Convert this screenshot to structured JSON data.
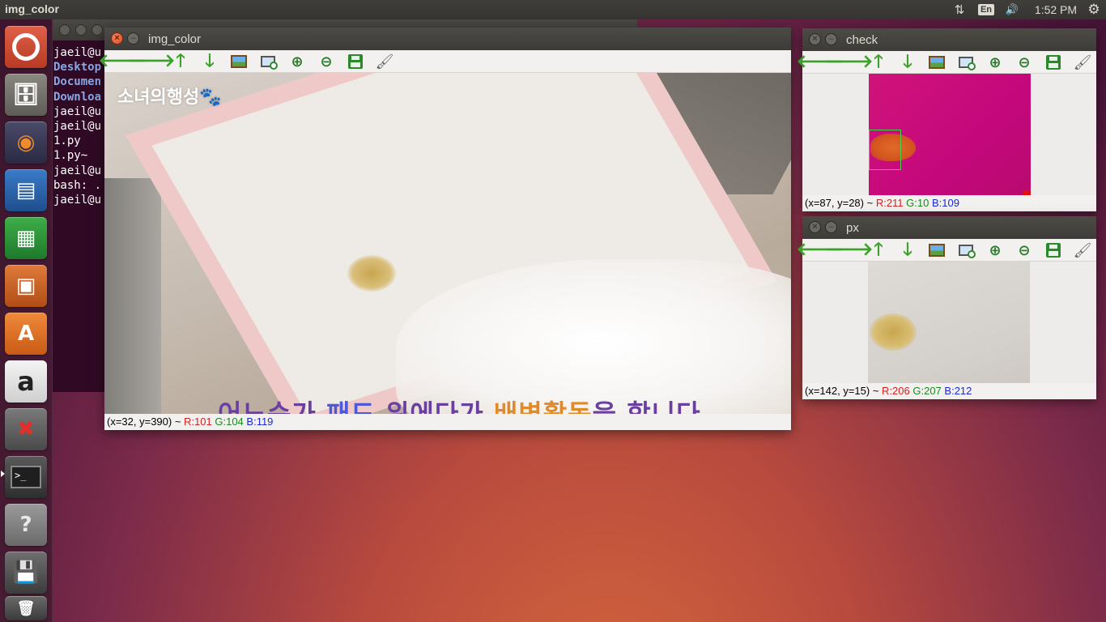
{
  "top_panel": {
    "title": "img_color",
    "keyboard_layout": "En",
    "clock": "1:52 PM",
    "network_icon": "network-updown-icon",
    "volume_icon": "volume-icon",
    "settings_icon": "gear-icon"
  },
  "launcher": {
    "items": [
      {
        "name": "ubuntu-dash",
        "icon": "ubuntu-logo-icon"
      },
      {
        "name": "files",
        "icon": "file-cabinet-icon"
      },
      {
        "name": "firefox",
        "icon": "firefox-icon"
      },
      {
        "name": "libreoffice-writer",
        "icon": "writer-icon"
      },
      {
        "name": "libreoffice-calc",
        "icon": "calc-icon"
      },
      {
        "name": "libreoffice-impress",
        "icon": "impress-icon"
      },
      {
        "name": "ubuntu-software",
        "icon": "software-bag-icon",
        "glyph": "A"
      },
      {
        "name": "amazon",
        "icon": "amazon-icon",
        "glyph": "a"
      },
      {
        "name": "system-settings",
        "icon": "settings-wrench-icon"
      },
      {
        "name": "terminal",
        "icon": "terminal-icon",
        "glyph": ">_"
      },
      {
        "name": "help",
        "icon": "help-icon",
        "glyph": "?"
      },
      {
        "name": "save-disk",
        "icon": "floppy-icon"
      },
      {
        "name": "trash",
        "icon": "trash-icon"
      }
    ]
  },
  "terminal": {
    "lines": [
      {
        "text": "jaeil@u",
        "style": "plain"
      },
      {
        "text": "Desktop",
        "style": "blue"
      },
      {
        "text": "Documen",
        "style": "blue"
      },
      {
        "text": "Downloa",
        "style": "blue"
      },
      {
        "text": "jaeil@u",
        "style": "plain"
      },
      {
        "text": "jaeil@u",
        "style": "plain"
      },
      {
        "text": "1.py",
        "style": "plain"
      },
      {
        "text": "1.py~",
        "style": "plain"
      },
      {
        "text": "jaeil@u",
        "style": "plain"
      },
      {
        "text": "bash: .",
        "style": "plain"
      },
      {
        "text": "jaeil@u",
        "style": "plain"
      }
    ]
  },
  "img_color_window": {
    "title": "img_color",
    "close_glyph": "×",
    "min_glyph": "–",
    "watermark": "소녀의행성🐾",
    "subtitle_parts": [
      "어느순가 ",
      "패드",
      " 위에다가 ",
      "배변활동",
      "을 합니다"
    ],
    "status": {
      "coords": "(x=32, y=390) ~ ",
      "r": "R:101",
      "g": "G:104",
      "b": "B:119"
    }
  },
  "check_window": {
    "title": "check",
    "close_glyph": "×",
    "min_glyph": "–",
    "status": {
      "coords": "(x=87, y=28) ~ ",
      "r": "R:211",
      "g": "G:10",
      "b": "B:109"
    }
  },
  "px_window": {
    "title": "px",
    "close_glyph": "×",
    "min_glyph": "–",
    "status": {
      "coords": "(x=142, y=15) ~ ",
      "r": "R:206",
      "g": "G:207",
      "b": "B:212"
    }
  },
  "toolbar": {
    "left_arrow": "🡐",
    "right_arrow": "🡒",
    "up_arrow": "🡑",
    "down_arrow": "🡓",
    "zoom_in": "⊕",
    "zoom_out": "⊖",
    "brush": "🖌",
    "tools": [
      "left-arrow-icon",
      "right-arrow-icon",
      "up-arrow-icon",
      "down-arrow-icon",
      "picture-icon",
      "zoom-fit-icon",
      "zoom-in-icon",
      "zoom-out-icon",
      "save-icon",
      "brush-icon"
    ]
  }
}
